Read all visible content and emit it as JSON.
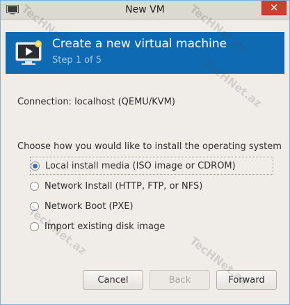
{
  "window": {
    "title": "New VM",
    "close_label": "✕"
  },
  "banner": {
    "title": "Create a new virtual machine",
    "step": "Step 1 of 5"
  },
  "connection": {
    "label": "Connection:",
    "value": "localhost (QEMU/KVM)"
  },
  "install": {
    "prompt": "Choose how you would like to install the operating system",
    "options": [
      {
        "label": "Local install media (ISO image or CDROM)",
        "selected": true
      },
      {
        "label": "Network Install (HTTP, FTP, or NFS)",
        "selected": false
      },
      {
        "label": "Network Boot (PXE)",
        "selected": false
      },
      {
        "label": "Import existing disk image",
        "selected": false
      }
    ]
  },
  "buttons": {
    "cancel": "Cancel",
    "back": "Back",
    "forward": "Forward"
  },
  "watermark": "TecHNet.az",
  "colors": {
    "banner_bg": "#0e6bb3",
    "close_bg": "#c84031",
    "radio_selected": "#3b6ea8"
  }
}
